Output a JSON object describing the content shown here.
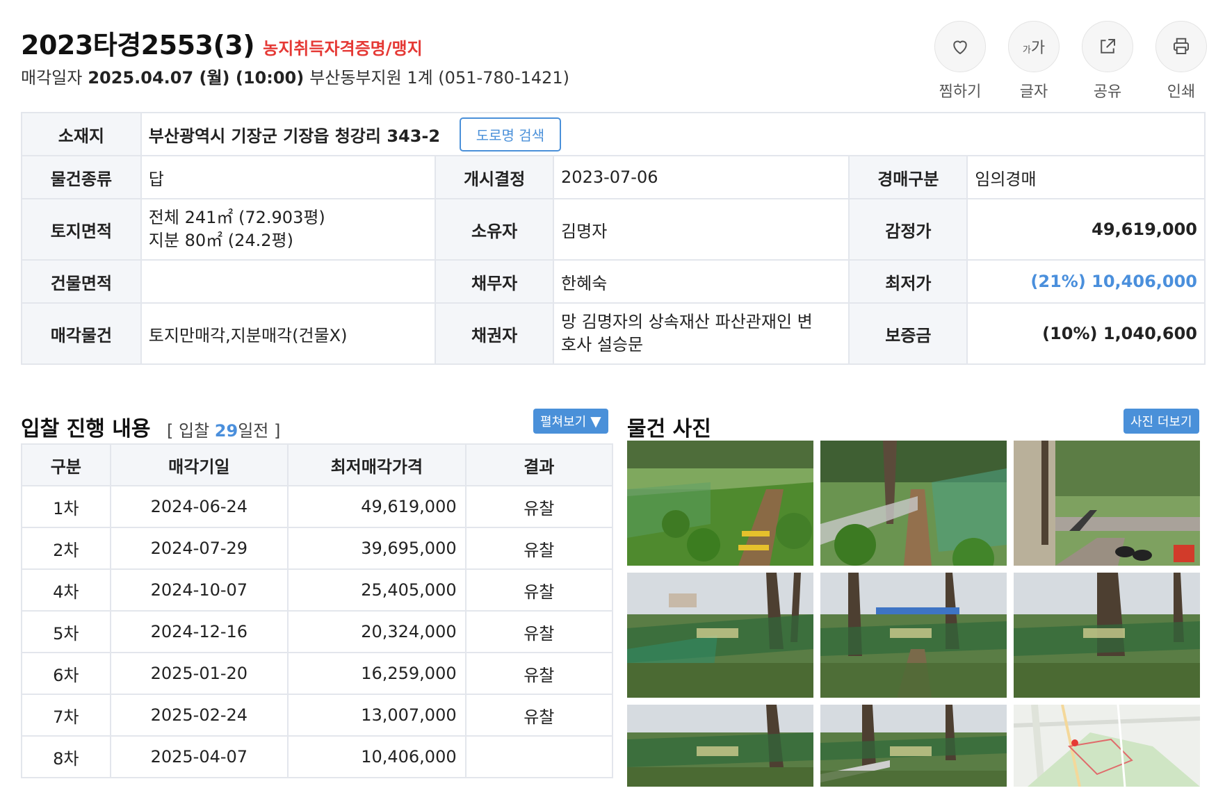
{
  "header": {
    "case_number": "2023타경2553(3)",
    "case_tag": "농지취득자격증명/맹지",
    "sale_date_label": "매각일자",
    "sale_date": "2025.04.07 (월) (10:00)",
    "court": "부산동부지원 1계 (051-780-1421)"
  },
  "toolbar": [
    {
      "label": "찜하기",
      "icon": "heart-icon"
    },
    {
      "label": "글자",
      "icon": "font-size-icon"
    },
    {
      "label": "공유",
      "icon": "share-icon"
    },
    {
      "label": "인쇄",
      "icon": "print-icon"
    }
  ],
  "font_glyph": {
    "small": "가",
    "big": "가"
  },
  "info": {
    "location_label": "소재지",
    "location": "부산광역시 기장군 기장읍 청강리 343-2",
    "road_search": "도로명 검색",
    "type_label": "물건종류",
    "type": "답",
    "start_label": "개시결정",
    "start": "2023-07-06",
    "auction_kind_label": "경매구분",
    "auction_kind": "임의경매",
    "land_area_label": "토지면적",
    "land_area_total": "전체 241㎡ (72.903평)",
    "land_area_share": "지분 80㎡ (24.2평)",
    "owner_label": "소유자",
    "owner": "김명자",
    "appraisal_label": "감정가",
    "appraisal": "49,619,000",
    "building_area_label": "건물면적",
    "building_area": "",
    "debtor_label": "채무자",
    "debtor": "한혜숙",
    "min_price_label": "최저가",
    "min_price": "(21%) 10,406,000",
    "sale_object_label": "매각물건",
    "sale_object": "토지만매각,지분매각(건물X)",
    "creditor_label": "채권자",
    "creditor_line1": "망 김명자의 상속재산 파산관재인 변",
    "creditor_line2": "호사 설승문",
    "deposit_label": "보증금",
    "deposit": "(10%) 1,040,600"
  },
  "bid_section": {
    "title": "입찰 진행 내용",
    "meta_prefix": "[ 입찰 ",
    "days": "29",
    "meta_suffix": "일전 ]",
    "expand_button": "펼쳐보기",
    "columns": [
      "구분",
      "매각기일",
      "최저매각가격",
      "결과"
    ],
    "rows": [
      {
        "round": "1차",
        "date": "2024-06-24",
        "price": "49,619,000",
        "result": "유찰"
      },
      {
        "round": "2차",
        "date": "2024-07-29",
        "price": "39,695,000",
        "result": "유찰"
      },
      {
        "round": "4차",
        "date": "2024-10-07",
        "price": "25,405,000",
        "result": "유찰"
      },
      {
        "round": "5차",
        "date": "2024-12-16",
        "price": "20,324,000",
        "result": "유찰"
      },
      {
        "round": "6차",
        "date": "2025-01-20",
        "price": "16,259,000",
        "result": "유찰"
      },
      {
        "round": "7차",
        "date": "2025-02-24",
        "price": "13,007,000",
        "result": "유찰"
      },
      {
        "round": "8차",
        "date": "2025-04-07",
        "price": "10,406,000",
        "result": ""
      }
    ]
  },
  "photo_section": {
    "title": "물건 사진",
    "more_button": "사진 더보기",
    "photos": [
      {
        "kind": "garden-path-photo"
      },
      {
        "kind": "garden-fence-photo"
      },
      {
        "kind": "stairs-tires-photo"
      },
      {
        "kind": "trees-net-photo"
      },
      {
        "kind": "trees-net-photo"
      },
      {
        "kind": "trees-net-photo"
      },
      {
        "kind": "trees-net-photo"
      },
      {
        "kind": "trees-fence-photo"
      },
      {
        "kind": "location-map"
      }
    ]
  },
  "colors": {
    "accent_blue": "#4a90d9",
    "tag_red": "#e53935",
    "header_bg": "#f4f6f9",
    "border": "#e3e6ec"
  }
}
